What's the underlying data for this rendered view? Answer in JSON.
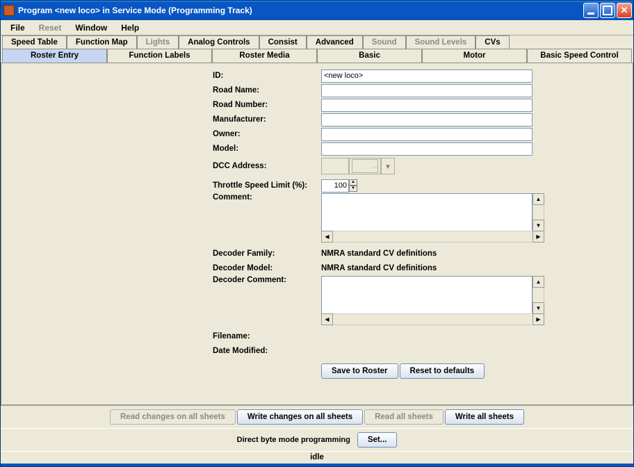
{
  "titlebar": {
    "title": "Program <new loco> in Service Mode (Programming Track)"
  },
  "menu": {
    "file": "File",
    "reset": "Reset",
    "window": "Window",
    "help": "Help"
  },
  "tabs_row1": {
    "speed_table": "Speed Table",
    "function_map": "Function Map",
    "lights": "Lights",
    "analog_controls": "Analog Controls",
    "consist": "Consist",
    "advanced": "Advanced",
    "sound": "Sound",
    "sound_levels": "Sound Levels",
    "cvs": "CVs"
  },
  "tabs_row2": {
    "roster_entry": "Roster Entry",
    "function_labels": "Function Labels",
    "roster_media": "Roster Media",
    "basic": "Basic",
    "motor": "Motor",
    "basic_speed_control": "Basic Speed Control"
  },
  "form": {
    "id_label": "ID:",
    "id_value": "<new loco>",
    "road_name_label": "Road Name:",
    "road_name_value": "",
    "road_number_label": "Road Number:",
    "road_number_value": "",
    "manufacturer_label": "Manufacturer:",
    "manufacturer_value": "",
    "owner_label": "Owner:",
    "owner_value": "",
    "model_label": "Model:",
    "model_value": "",
    "dcc_address_label": "DCC Address:",
    "dcc_combo_text": "...",
    "throttle_label": "Throttle Speed Limit (%):",
    "throttle_value": "100",
    "comment_label": "Comment:",
    "comment_value": "",
    "decoder_family_label": "Decoder Family:",
    "decoder_family_value": "NMRA standard CV definitions",
    "decoder_model_label": "Decoder Model:",
    "decoder_model_value": "NMRA standard CV definitions",
    "decoder_comment_label": "Decoder Comment:",
    "decoder_comment_value": "",
    "filename_label": "Filename:",
    "filename_value": "",
    "date_modified_label": "Date Modified:",
    "date_modified_value": ""
  },
  "buttons": {
    "save_to_roster": "Save to Roster",
    "reset_to_defaults": "Reset to defaults",
    "read_changes": "Read changes on all sheets",
    "write_changes": "Write changes on all sheets",
    "read_all": "Read all sheets",
    "write_all": "Write all sheets",
    "set": "Set..."
  },
  "mode_label": "Direct byte mode programming",
  "status": "idle"
}
